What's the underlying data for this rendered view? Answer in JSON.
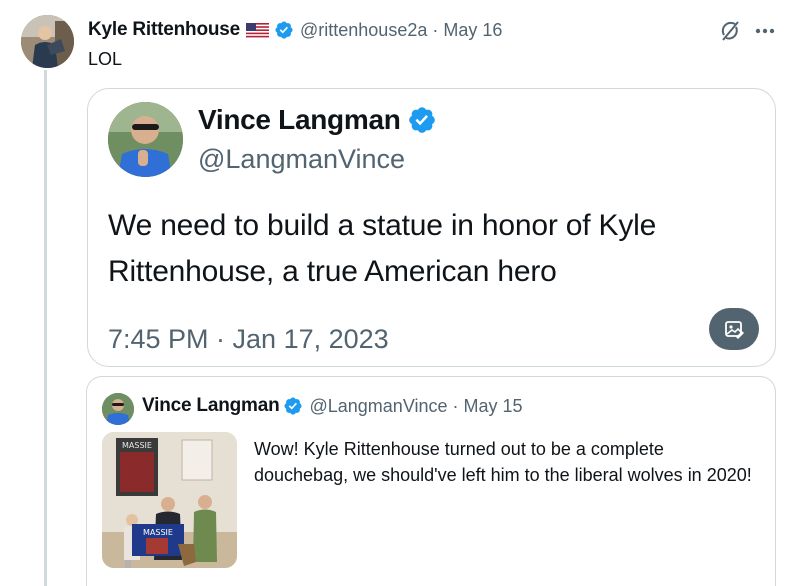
{
  "tweet": {
    "author_name": "Kyle Rittenhouse",
    "flag_icon": "us-flag-icon",
    "handle": "@rittenhouse2a",
    "date": "· May 16",
    "text": "LOL"
  },
  "quoted_tweet": {
    "author_name": "Vince Langman",
    "handle": "@LangmanVince",
    "text": "We need to build a statue in honor of Kyle Rittenhouse, a true American hero",
    "timestamp": "7:45 PM · Jan 17, 2023"
  },
  "embedded_quote": {
    "author_name": "Vince Langman",
    "handle": "@LangmanVince",
    "date": "· May 15",
    "text": "Wow! Kyle Rittenhouse turned out to be a complete douchebag, we should've left him to the liberal wolves in 2020!",
    "image_banner_text": "MASSIE"
  },
  "colors": {
    "verified": "#1d9bf0",
    "secondary_text": "#536471",
    "border": "#cfd9de"
  }
}
